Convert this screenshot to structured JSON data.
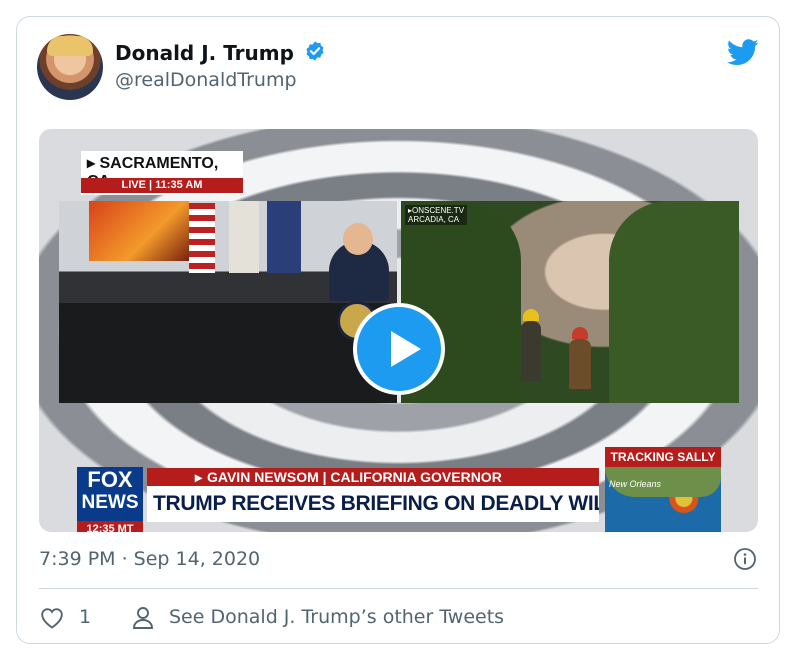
{
  "tweet": {
    "display_name": "Donald J. Trump",
    "handle": "@realDonaldTrump",
    "timestamp": "7:39 PM · Sep 14, 2020",
    "like_count": "1",
    "see_other_tweets": "See Donald J. Trump’s other Tweets"
  },
  "video": {
    "location": "SACRAMENTO, CA",
    "live_bar": "LIVE | 11:35 AM",
    "onscene_1": "ONSCENE.TV",
    "onscene_2": "ARCADIA, CA",
    "name_bar": "GAVIN NEWSOM | CALIFORNIA GOVERNOR",
    "headline": "TRUMP RECEIVES BRIEFING ON DEADLY WILDFIRES",
    "network_line1": "FOX",
    "network_line2": "NEWS",
    "network_time": "12:35 MT",
    "tracking": "TRACKING SALLY",
    "map_label": "New Orleans"
  },
  "icons": {
    "verified": "verified-badge-icon",
    "brand": "twitter-bird-icon",
    "play": "play-icon",
    "info": "info-icon",
    "like": "heart-icon",
    "profile": "person-icon"
  },
  "colors": {
    "accent": "#1d9bf0",
    "text_primary": "#0f1419",
    "text_secondary": "#536471",
    "border": "#cfd9de",
    "fox_red": "#b51d1d",
    "fox_blue": "#0a3a8a"
  }
}
